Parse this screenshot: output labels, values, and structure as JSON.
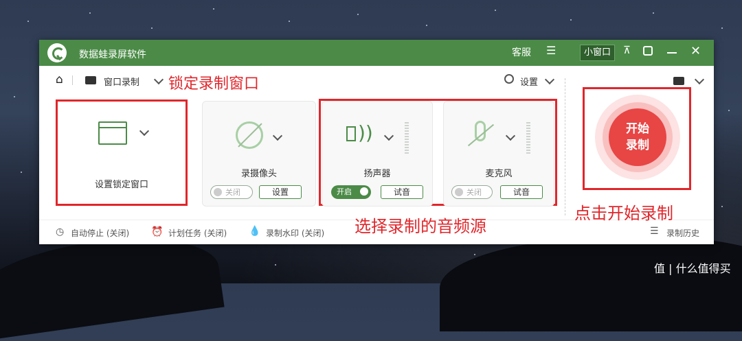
{
  "app": {
    "title": "数据蛙录屏软件"
  },
  "titlebar": {
    "service": "客服",
    "mini_window": "小窗口"
  },
  "toolbar": {
    "home": "窗口录制",
    "settings": "设置"
  },
  "annotations": {
    "lock_window": "锁定录制窗口",
    "select_audio": "选择录制的音频源",
    "click_start": "点击开始录制"
  },
  "cards": {
    "lock_window": {
      "label": "设置锁定窗口"
    },
    "camera": {
      "label": "录摄像头",
      "toggle": "关闭",
      "button": "设置"
    },
    "speaker": {
      "label": "扬声器",
      "toggle": "开启",
      "button": "试音"
    },
    "mic": {
      "label": "麦克风",
      "toggle": "关闭",
      "button": "试音"
    }
  },
  "start": {
    "line1": "开始",
    "line2": "录制"
  },
  "footer": {
    "auto_stop": "自动停止 (关闭)",
    "schedule": "计划任务 (关闭)",
    "watermark": "录制水印 (关闭)",
    "history": "录制历史"
  },
  "watermark_text": "值 | 什么值得买",
  "colors": {
    "brand": "#4b8b47",
    "accent_red": "#e0262b",
    "start_red": "#e84545"
  }
}
